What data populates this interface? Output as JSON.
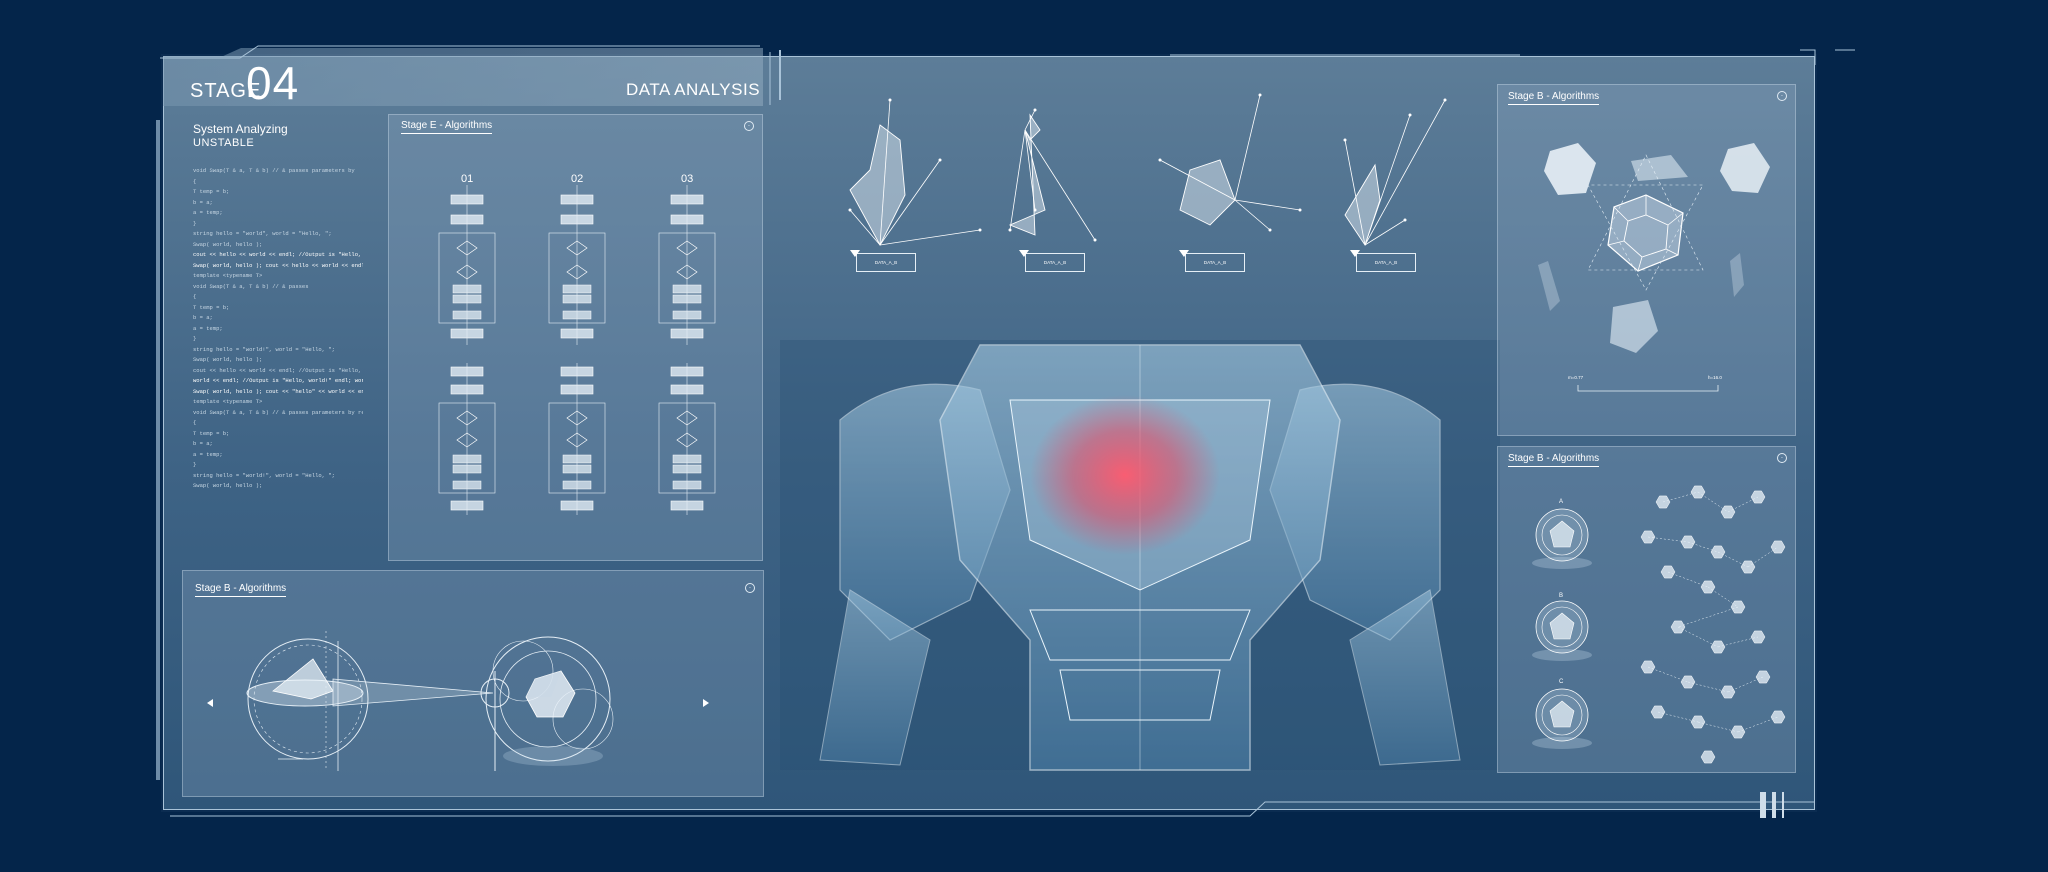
{
  "header": {
    "stage_label": "STAGE",
    "stage_number": "04",
    "section_title": "DATA ANALYSIS"
  },
  "system": {
    "title": "System Analyzing",
    "status": "UNSTABLE"
  },
  "code_lines": [
    "void Swap(T & a, T & b) // & passes parameters by",
    "{",
    "  T temp = b;",
    "  b = a;",
    "  a = temp;",
    "}",
    "string hello = \"world\", world = \"Hello, \";",
    "Swap( world, hello );",
    "cout << hello << world << endl; //Output is \"Hello,",
    "Swap( world, hello ); cout << hello << world << endl;",
    "",
    "template <typename T>",
    "void Swap(T & a, T & b) // & passes",
    "{",
    "  T temp = b;",
    "  b = a;",
    "  a = temp;",
    "}",
    "",
    "string hello = \"world!\", world = \"Hello, \";",
    "Swap( world, hello );",
    "cout << hello << world << endl; //Output is \"Hello, wor",
    "world << endl; //Output is \"Hello, world!\" endl; world <",
    "Swap( world, hello ); cout << \"hello\" << world << endl;",
    "template <typename T>",
    "",
    "void Swap(T & a, T & b) // & passes parameters by reference",
    "{",
    "  T temp = b;",
    "  b = a;",
    "  a = temp;",
    "}",
    "string hello = \"world!\", world = \"Hello, \";",
    "Swap( world, hello );"
  ],
  "panels": {
    "algorithms_center": {
      "title": "Stage E - Algorithms",
      "columns": [
        "01",
        "02",
        "03"
      ]
    },
    "algorithms_bottom_left": {
      "title": "Stage B - Algorithms"
    },
    "algorithms_top_right": {
      "title": "Stage B - Algorithms",
      "scale_left": "m=0.77",
      "scale_right": "h=16.0"
    },
    "algorithms_bottom_right": {
      "title": "Stage B - Algorithms",
      "sphere_labels": [
        "A",
        "B",
        "C"
      ]
    }
  },
  "radar_charts": [
    {
      "label": "DATA_A_B"
    },
    {
      "label": "DATA_A_B"
    },
    {
      "label": "DATA_A_B"
    },
    {
      "label": "DATA_A_B"
    }
  ],
  "colors": {
    "background": "#04254a",
    "frame": "#3e6385",
    "accent_core": "#ff5a6e",
    "line": "#e6eff6"
  },
  "icons": [
    "settings-icon",
    "arrow-left-icon",
    "arrow-right-icon",
    "pointer-icon"
  ]
}
